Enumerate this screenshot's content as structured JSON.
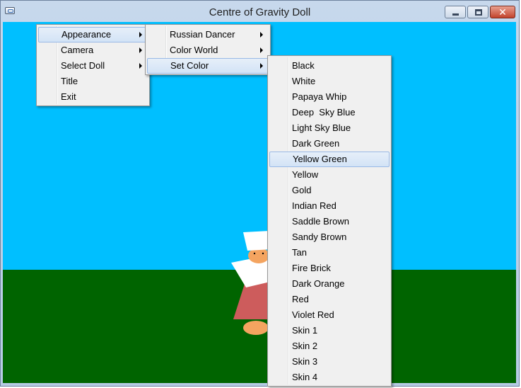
{
  "window": {
    "title": "Centre of Gravity Doll",
    "icon": "app-window-icon",
    "controls": {
      "minimize": "minimize-icon",
      "maximize": "maximize-icon",
      "close": "close-icon",
      "close_glyph": "✕"
    }
  },
  "scene": {
    "sky_color": "#00bfff",
    "ground_color": "#006400",
    "doll": {
      "hat": "#ffffff",
      "face": "#f4a460",
      "collar": "#ffffff",
      "dress": "#cd5c5c",
      "legs": "#f4a460"
    }
  },
  "menu": {
    "main": [
      {
        "label": "Appearance",
        "has_submenu": true,
        "highlighted": true
      },
      {
        "label": "Camera",
        "has_submenu": true
      },
      {
        "label": "Select Doll",
        "has_submenu": true
      },
      {
        "label": "Title",
        "has_submenu": false
      },
      {
        "label": "Exit",
        "has_submenu": false
      }
    ],
    "appearance": [
      {
        "label": "Russian Dancer",
        "has_submenu": true
      },
      {
        "label": "Color World",
        "has_submenu": true
      },
      {
        "label": "Set Color",
        "has_submenu": true,
        "highlighted": true
      }
    ],
    "set_color": [
      {
        "label": "Black"
      },
      {
        "label": "White"
      },
      {
        "label": "Papaya Whip"
      },
      {
        "label": "Deep  Sky Blue"
      },
      {
        "label": "Light Sky Blue"
      },
      {
        "label": "Dark Green"
      },
      {
        "label": "Yellow Green",
        "highlighted": true
      },
      {
        "label": "Yellow"
      },
      {
        "label": "Gold"
      },
      {
        "label": "Indian Red"
      },
      {
        "label": "Saddle Brown"
      },
      {
        "label": "Sandy Brown"
      },
      {
        "label": "Tan"
      },
      {
        "label": "Fire Brick"
      },
      {
        "label": "Dark Orange"
      },
      {
        "label": "Red"
      },
      {
        "label": "Violet Red"
      },
      {
        "label": "Skin 1"
      },
      {
        "label": "Skin 2"
      },
      {
        "label": "Skin 3"
      },
      {
        "label": "Skin 4"
      }
    ]
  }
}
